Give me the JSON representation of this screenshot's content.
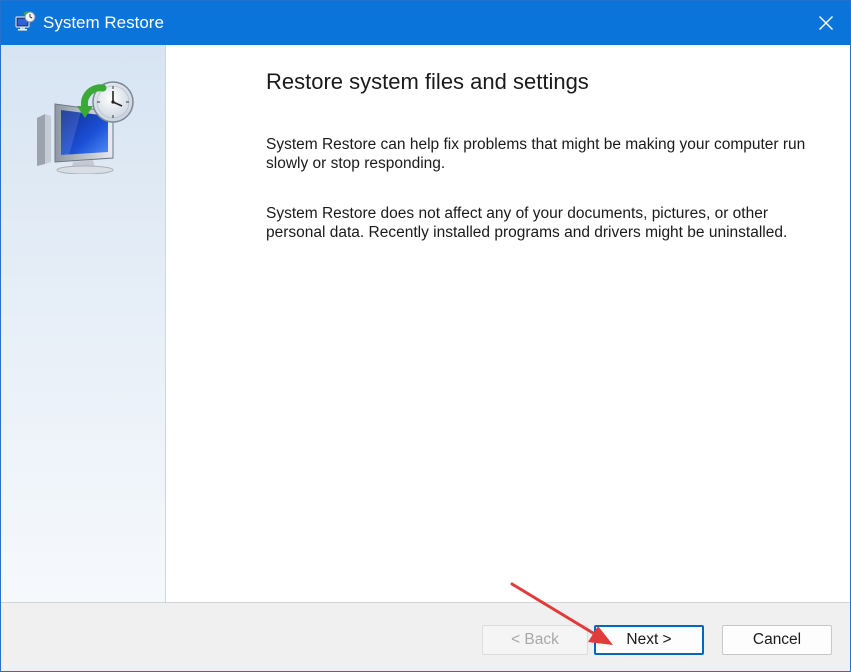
{
  "window": {
    "title": "System Restore",
    "close_label": "✕"
  },
  "content": {
    "heading": "Restore system files and settings",
    "paragraph1": "System Restore can help fix problems that might be making your computer run slowly or stop responding.",
    "paragraph2": "System Restore does not affect any of your documents, pictures, or other personal data. Recently installed programs and drivers might be uninstalled."
  },
  "buttons": {
    "back": "< Back",
    "next": "Next >",
    "cancel": "Cancel"
  },
  "icons": {
    "title": "system-restore-icon",
    "wizard": "system-restore-monitor-clock-icon",
    "close": "close-icon"
  },
  "colors": {
    "titlebar": "#0a74da",
    "annotation_arrow": "#e03c3c",
    "next_border": "#0067c0"
  }
}
